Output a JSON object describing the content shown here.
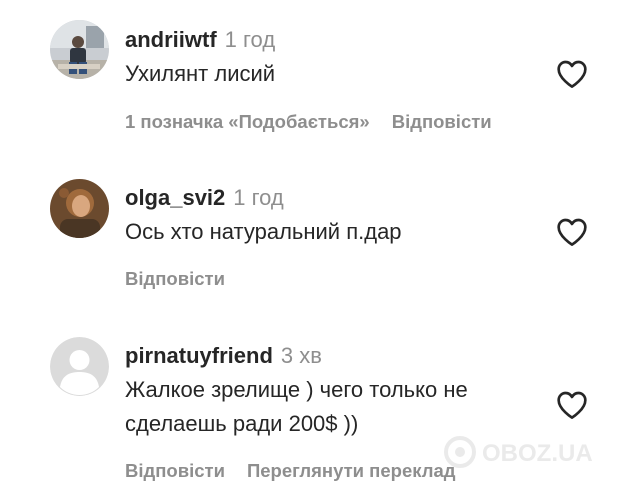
{
  "comments": [
    {
      "username": "andriiwtf",
      "time": "1 год",
      "text": "Ухилянт лисий",
      "likes_label": "1 позначка «Подобається»",
      "reply_label": "Відповісти",
      "avatar_icon": "user-photo-avatar"
    },
    {
      "username": "olga_svi2",
      "time": "1 год",
      "text": "Ось хто натуральний п.дар",
      "reply_label": "Відповісти",
      "avatar_icon": "user-photo-avatar"
    },
    {
      "username": "pirnatuyfriend",
      "time": "3 хв",
      "text_line1": "Жалкое зрелище ) чего только не",
      "text_line2": "сделаешь ради 200$ ))",
      "reply_label": "Відповісти",
      "translate_label": "Переглянути переклад",
      "avatar_icon": "default-user-avatar"
    }
  ],
  "watermark": "OBOZ.UA",
  "colors": {
    "text": "#262626",
    "secondary": "#8e8e8e",
    "background": "#ffffff"
  }
}
